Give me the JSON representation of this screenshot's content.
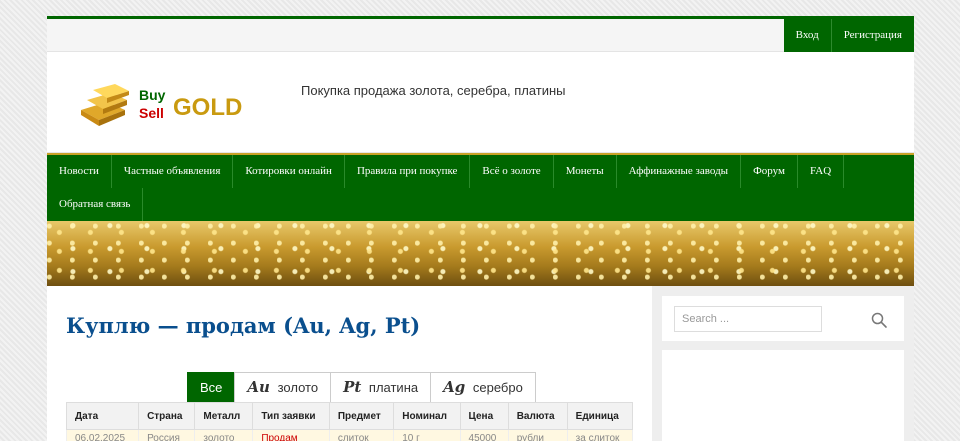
{
  "topbar": {
    "links": [
      "Вход",
      "Регистрация"
    ]
  },
  "header": {
    "logo": {
      "word_buy": "Buy",
      "word_sell": "Sell",
      "word_gold": "GOLD"
    },
    "tagline": "Покупка продажа золота, серебра, платины"
  },
  "nav": {
    "items": [
      "Новости",
      "Частные объявления",
      "Котировки онлайн",
      "Правила при покупке",
      "Всё о золоте",
      "Монеты",
      "Аффинажные заводы",
      "Форум",
      "FAQ",
      "Обратная связь"
    ]
  },
  "main": {
    "title": "Куплю — продам (Au, Ag, Pt)",
    "tabs": [
      {
        "symbol": "",
        "label": "Все"
      },
      {
        "symbol": "Au",
        "label": "золото"
      },
      {
        "symbol": "Pt",
        "label": "платина"
      },
      {
        "symbol": "Ag",
        "label": "серебро"
      }
    ],
    "table": {
      "headers": [
        "Дата",
        "Страна",
        "Металл",
        "Тип заявки",
        "Предмет",
        "Номинал",
        "Цена",
        "Валюта",
        "Единица"
      ],
      "rows": [
        [
          "06.02.2025",
          "Россия",
          "золото",
          "Продам",
          "слиток",
          "10 г",
          "45000",
          "рубли",
          "за слиток"
        ]
      ]
    }
  },
  "sidebar": {
    "search_placeholder": "Search ..."
  },
  "colors": {
    "brand_green": "#006600",
    "title_blue": "#0a4f8e",
    "gold": "#c9a227"
  }
}
